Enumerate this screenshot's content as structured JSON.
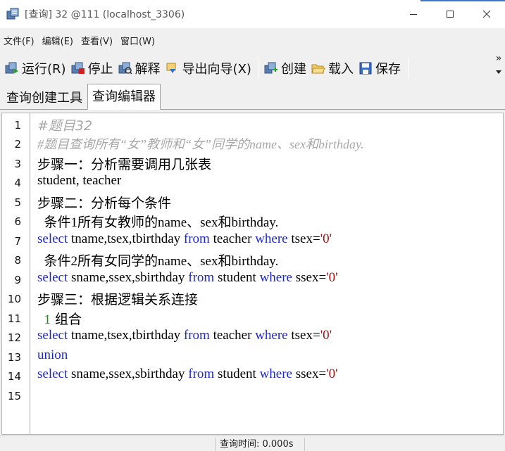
{
  "window": {
    "title": "[查询] 32 @111 (localhost_3306)",
    "controls": {
      "minimize": "—",
      "maximize": "☐",
      "close": "✕"
    }
  },
  "menu": [
    "文件(F)",
    "编辑(E)",
    "查看(V)",
    "窗口(W)"
  ],
  "toolbar": {
    "run": "运行(R)",
    "stop": "停止",
    "explain": "解释",
    "export": "导出向导(X)",
    "create": "创建",
    "load": "载入",
    "save": "保存",
    "overflow": "»"
  },
  "tabs": [
    "查询创建工具",
    "查询编辑器"
  ],
  "active_tab": "查询编辑器",
  "editor": {
    "line_numbers": [
      "1",
      "2",
      "3",
      "4",
      "5",
      "6",
      "7",
      "8",
      "9",
      "10",
      "11",
      "12",
      "13",
      "14",
      "15"
    ],
    "lines": [
      {
        "text": "#题目32"
      },
      {
        "text": "#题目查询所有“女”教师和“女”同学的name、sex和birthday."
      },
      {
        "text": "步骤一：分析需要调用几张表"
      },
      {
        "text": "student, teacher"
      },
      {
        "text": "步骤二：分析每个条件"
      },
      {
        "text": "  条件1所有女教师的name、sex和birthday."
      },
      {
        "k1": "select",
        "t1": " tname,tsex,tbirthday ",
        "k2": "from",
        "t2": " teacher ",
        "k3": "where",
        "t3": " tsex=",
        "s": "'0'"
      },
      {
        "text": "  条件2所有女同学的name、sex和birthday."
      },
      {
        "k1": "select",
        "t1": " sname,ssex,sbirthday ",
        "k2": "from",
        "t2": " student ",
        "k3": "where",
        "t3": " ssex=",
        "s": "'0'"
      },
      {
        "text": "步骤三：根据逻辑关系连接"
      },
      {
        "n": "1",
        "text": " 组合"
      },
      {
        "k1": "select",
        "t1": " tname,tsex,tbirthday ",
        "k2": "from",
        "t2": " teacher ",
        "k3": "where",
        "t3": " tsex=",
        "s": "'0'"
      },
      {
        "k1": "union"
      },
      {
        "k1": "select",
        "t1": " sname,ssex,sbirthday ",
        "k2": "from",
        "t2": " student ",
        "k3": "where",
        "t3": " ssex=",
        "s": "'0'"
      },
      {
        "text": ""
      }
    ]
  },
  "status": {
    "query_time": "查询时间: 0.000s"
  },
  "colors": {
    "keyword": "#1e28c8",
    "comment": "#a8a8a8",
    "string": "#a01414",
    "number": "#1e8c1e"
  }
}
